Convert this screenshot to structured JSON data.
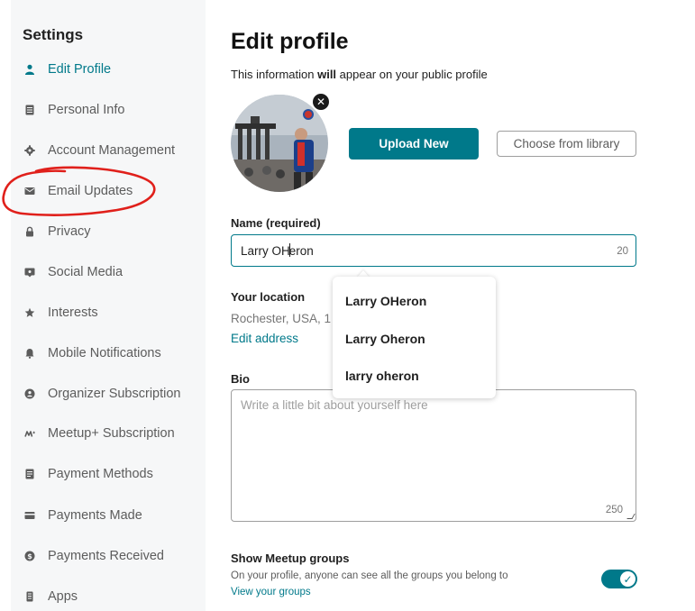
{
  "sidebar": {
    "title": "Settings",
    "items": [
      {
        "label": "Edit Profile",
        "icon": "person-icon",
        "active": true
      },
      {
        "label": "Personal Info",
        "icon": "document-icon"
      },
      {
        "label": "Account Management",
        "icon": "gear-icon"
      },
      {
        "label": "Email Updates",
        "icon": "envelope-icon"
      },
      {
        "label": "Privacy",
        "icon": "lock-icon"
      },
      {
        "label": "Social Media",
        "icon": "chat-icon"
      },
      {
        "label": "Interests",
        "icon": "star-icon"
      },
      {
        "label": "Mobile Notifications",
        "icon": "bell-icon"
      },
      {
        "label": "Organizer Subscription",
        "icon": "badge-icon"
      },
      {
        "label": "Meetup+ Subscription",
        "icon": "meetup-icon"
      },
      {
        "label": "Payment Methods",
        "icon": "card-list-icon"
      },
      {
        "label": "Payments Made",
        "icon": "credit-card-icon"
      },
      {
        "label": "Payments Received",
        "icon": "dollar-icon"
      },
      {
        "label": "Apps",
        "icon": "phone-icon"
      }
    ]
  },
  "main": {
    "title": "Edit profile",
    "subtitle_pre": "This information ",
    "subtitle_bold": "will",
    "subtitle_post": " appear on your public profile",
    "upload_button": "Upload New",
    "library_button": "Choose from library",
    "avatar_remove": "✕",
    "name": {
      "label": "Name (required)",
      "value_before_caret": "Larry OH",
      "value_after_caret": "eron",
      "count": "20"
    },
    "autocomplete": [
      "Larry OHeron",
      "Larry Oheron",
      "larry oheron"
    ],
    "location": {
      "label": "Your location",
      "value": "Rochester, USA, 1",
      "edit_link": "Edit address"
    },
    "bio": {
      "label": "Bio",
      "placeholder": "Write a little bit about yourself here",
      "count": "250"
    },
    "groups": {
      "title": "Show Meetup groups",
      "description": "On your profile, anyone can see all the groups you belong to",
      "link": "View your groups",
      "enabled": true
    }
  },
  "colors": {
    "accent": "#00798a",
    "sidebar_bg": "#f6f7f8",
    "annotation": "#e0201b"
  }
}
